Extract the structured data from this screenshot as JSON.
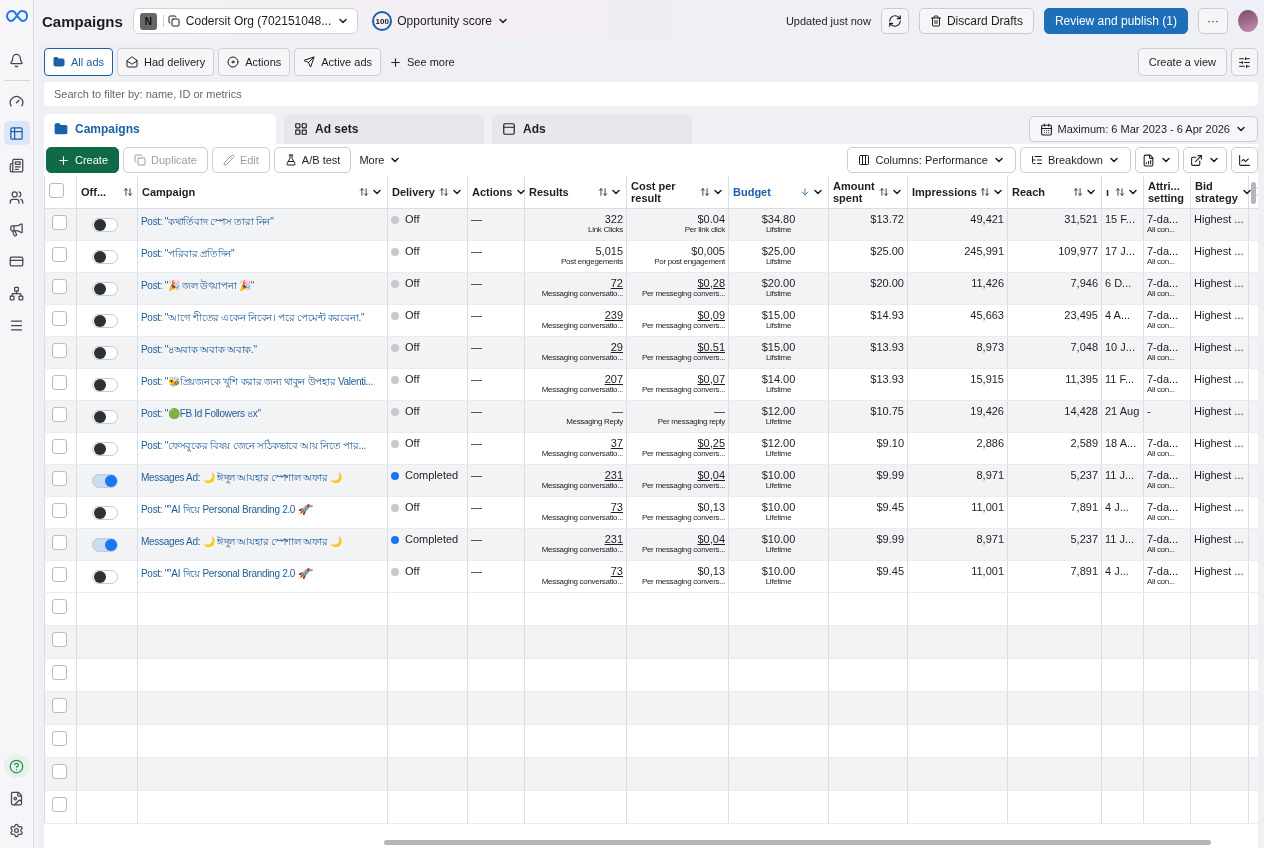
{
  "header": {
    "title": "Campaigns",
    "account": {
      "initial": "N",
      "name": "Codersit Org (702151048..."
    },
    "score": {
      "value": "100",
      "label": "Opportunity score"
    },
    "updated": "Updated just now",
    "discard": "Discard Drafts",
    "publish": "Review and publish (1)",
    "more": "···"
  },
  "filters": {
    "chips": [
      {
        "label": "All ads",
        "selected": true
      },
      {
        "label": "Had delivery",
        "selected": false
      },
      {
        "label": "Actions",
        "selected": false
      },
      {
        "label": "Active ads",
        "selected": false
      }
    ],
    "see_more": "See more",
    "create_view": "Create a view"
  },
  "search": {
    "placeholder": "Search to filter by: name, ID or metrics"
  },
  "tabs": [
    {
      "label": "Campaigns",
      "selected": true
    },
    {
      "label": "Ad sets",
      "selected": false
    },
    {
      "label": "Ads",
      "selected": false
    }
  ],
  "date_range": "Maximum: 6 Mar 2023 - 6 Apr 2026",
  "toolbar": {
    "create": "Create",
    "duplicate": {
      "label": "Duplicate",
      "disabled": true
    },
    "edit": {
      "label": "Edit",
      "disabled": true
    },
    "ab_test": "A/B test",
    "more": "More",
    "columns": "Columns: Performance",
    "breakdown": "Breakdown"
  },
  "table": {
    "columns": [
      {
        "label": "Off...",
        "sortable": true,
        "sorted": false,
        "menu": false
      },
      {
        "label": "Campaign",
        "sortable": true,
        "sorted": false,
        "menu": true
      },
      {
        "label": "Delivery",
        "sortable": true,
        "sorted": false,
        "menu": true
      },
      {
        "label": "Actions",
        "sortable": false,
        "sorted": false,
        "menu": true
      },
      {
        "label": "Results",
        "sortable": true,
        "sorted": false,
        "menu": true
      },
      {
        "label": "Cost per result",
        "sortable": true,
        "sorted": false,
        "menu": true
      },
      {
        "label": "Budget",
        "sortable": true,
        "sorted": true,
        "menu": true
      },
      {
        "label": "Amount spent",
        "sortable": true,
        "sorted": false,
        "menu": true
      },
      {
        "label": "Impressions",
        "sortable": true,
        "sorted": false,
        "menu": true
      },
      {
        "label": "Reach",
        "sortable": true,
        "sorted": false,
        "menu": true
      },
      {
        "label": "ı",
        "sortable": true,
        "sorted": false,
        "menu": true
      },
      {
        "label": "Attri... setting",
        "sortable": false,
        "sorted": false,
        "menu": false
      },
      {
        "label": "Bid strategy",
        "sortable": false,
        "sorted": false,
        "menu": true
      }
    ],
    "select_all": {
      "checked": false
    },
    "empty_rows": [
      {
        "checked": false
      },
      {
        "checked": false
      },
      {
        "checked": false
      },
      {
        "checked": false
      },
      {
        "checked": false
      },
      {
        "checked": false
      },
      {
        "checked": false
      }
    ],
    "rows": [
      {
        "checked": false,
        "on": false,
        "campaign": "Post: \"কথার্তিবাদ স্পেস তারা নিন\"",
        "delivery": {
          "status": "Off",
          "color": "#c6c8cc"
        },
        "actions": "—",
        "result": {
          "value": "322",
          "label": "Link Clicks",
          "underlined": false
        },
        "cost": {
          "value": "$0.04",
          "label": "Per link click",
          "underlined": false
        },
        "budget": {
          "value": "$34.80",
          "label": "Lifstime"
        },
        "spent": "$13.72",
        "impressions": "49,421",
        "reach": "31,521",
        "ends": "15 F...",
        "attribution": {
          "value": "7-da...",
          "label": "All con..."
        },
        "bid": "Highest ..."
      },
      {
        "checked": false,
        "on": false,
        "campaign": "Post: \"পরিবার প্রতিদিন\"",
        "delivery": {
          "status": "Off",
          "color": "#c6c8cc"
        },
        "actions": "—",
        "result": {
          "value": "5,015",
          "label": "Post engegements",
          "underlined": false
        },
        "cost": {
          "value": "$0,005",
          "label": "Por post engagement",
          "underlined": false
        },
        "budget": {
          "value": "$25.00",
          "label": "Lifstime"
        },
        "spent": "$25.00",
        "impressions": "245,991",
        "reach": "109,977",
        "ends": "17 J...",
        "attribution": {
          "value": "7-da...",
          "label": "All con..."
        },
        "bid": "Highest ..."
      },
      {
        "checked": false,
        "on": false,
        "campaign": "Post: \"🎉 জল উৎযাপনা 🎉\"",
        "delivery": {
          "status": "Off",
          "color": "#c6c8cc"
        },
        "actions": "—",
        "result": {
          "value": "72",
          "label": "Messaging conversatio...",
          "underlined": true
        },
        "cost": {
          "value": "$0,28",
          "label": "Per messeging convers...",
          "underlined": true
        },
        "budget": {
          "value": "$20.00",
          "label": "Lifstime"
        },
        "spent": "$20.00",
        "impressions": "11,426",
        "reach": "7,946",
        "ends": "6 D...",
        "attribution": {
          "value": "7-da...",
          "label": "All con..."
        },
        "bid": "Highest ..."
      },
      {
        "checked": false,
        "on": false,
        "campaign": "Post: \"আগে শীতের একেন নিবেন। পরে পেমেন্ট করবেনা.\"",
        "delivery": {
          "status": "Off",
          "color": "#c6c8cc"
        },
        "actions": "—",
        "result": {
          "value": "239",
          "label": "Messeging conversatio...",
          "underlined": true
        },
        "cost": {
          "value": "$0,09",
          "label": "Per messaging convers...",
          "underlined": true
        },
        "budget": {
          "value": "$15.00",
          "label": "Lifstime"
        },
        "spent": "$14.93",
        "impressions": "45,663",
        "reach": "23,495",
        "ends": "4 A...",
        "attribution": {
          "value": "7-da...",
          "label": "All con..."
        },
        "bid": "Highest ..."
      },
      {
        "checked": false,
        "on": false,
        "campaign": "Post: \"৪অবাক অবাক অবাক.\"",
        "delivery": {
          "status": "Off",
          "color": "#c6c8cc"
        },
        "actions": "—",
        "result": {
          "value": "29",
          "label": "Messaging conversatio...",
          "underlined": true
        },
        "cost": {
          "value": "$0.51",
          "label": "Per messaging convers...",
          "underlined": true
        },
        "budget": {
          "value": "$15.00",
          "label": "Lifstime"
        },
        "spent": "$13.93",
        "impressions": "8,973",
        "reach": "7,048",
        "ends": "10 J...",
        "attribution": {
          "value": "7-da...",
          "label": "All con..."
        },
        "bid": "Highest ..."
      },
      {
        "checked": false,
        "on": false,
        "campaign": "Post: \"🐝প্রিয়জনকে খুশি করার জন্য থাকুন উপহার Valenti...",
        "delivery": {
          "status": "Off",
          "color": "#c6c8cc"
        },
        "actions": "—",
        "result": {
          "value": "207",
          "label": "Messaging conversatio...",
          "underlined": true
        },
        "cost": {
          "value": "$0,07",
          "label": "Per messaging convers...",
          "underlined": true
        },
        "budget": {
          "value": "$14.00",
          "label": "Lifstime"
        },
        "spent": "$13.93",
        "impressions": "15,915",
        "reach": "11,395",
        "ends": "11 F...",
        "attribution": {
          "value": "7-da...",
          "label": "All con..."
        },
        "bid": "Highest ..."
      },
      {
        "checked": false,
        "on": false,
        "campaign": "Post: \"🟢FB Id Followers ৪x\"",
        "delivery": {
          "status": "Off",
          "color": "#c6c8cc"
        },
        "actions": "—",
        "result": {
          "value": "—",
          "label": "Messaging Reply",
          "underlined": false
        },
        "cost": {
          "value": "—",
          "label": "Per messaging reply",
          "underlined": false
        },
        "budget": {
          "value": "$12.00",
          "label": "Lifetime"
        },
        "spent": "$10.75",
        "impressions": "19,426",
        "reach": "14,428",
        "ends": "21 Aug",
        "attribution": {
          "value": "-"
        },
        "bid": "Highest ..."
      },
      {
        "checked": false,
        "on": false,
        "campaign": "Post: \"ফেসবুকের বিষয় জেনে সঠিকভাবে আয় নিতে পার...",
        "delivery": {
          "status": "Off",
          "color": "#c6c8cc"
        },
        "actions": "—",
        "result": {
          "value": "37",
          "label": "Messaging conversatio...",
          "underlined": true
        },
        "cost": {
          "value": "$0,25",
          "label": "Per messaging convers...",
          "underlined": true
        },
        "budget": {
          "value": "$12.00",
          "label": "Lifetime"
        },
        "spent": "$9.10",
        "impressions": "2,886",
        "reach": "2,589",
        "ends": "18 A...",
        "attribution": {
          "value": "7-da...",
          "label": "All con..."
        },
        "bid": "Highest ..."
      },
      {
        "checked": false,
        "on": true,
        "campaign": "Messages Ad: 🌙 ঈদুল আযহার স্পেশাল অফার 🌙",
        "delivery": {
          "status": "Completed",
          "color": "#1877f2"
        },
        "actions": "—",
        "result": {
          "value": "231",
          "label": "Messaging conversatio...",
          "underlined": true
        },
        "cost": {
          "value": "$0,04",
          "label": "Per messaging convers...",
          "underlined": true
        },
        "budget": {
          "value": "$10.00",
          "label": "Lifetime"
        },
        "spent": "$9.99",
        "impressions": "8,971",
        "reach": "5,237",
        "ends": "11 J...",
        "attribution": {
          "value": "7-da...",
          "label": "All con..."
        },
        "bid": "Highest ..."
      },
      {
        "checked": false,
        "on": false,
        "campaign": "Post: \"\"AI দিয়ে Personal Branding 2.0 🚀\"",
        "delivery": {
          "status": "Off",
          "color": "#c6c8cc"
        },
        "actions": "—",
        "result": {
          "value": "73",
          "label": "Messaging conversatio...",
          "underlined": true
        },
        "cost": {
          "value": "$0,13",
          "label": "Per messaging convers...",
          "underlined": false
        },
        "budget": {
          "value": "$10.00",
          "label": "Lifetime"
        },
        "spent": "$9.45",
        "impressions": "11,001",
        "reach": "7,891",
        "ends": "4 J...",
        "attribution": {
          "value": "7-da...",
          "label": "All con..."
        },
        "bid": "Highest ..."
      },
      {
        "checked": false,
        "on": true,
        "campaign": "Messages Ad: 🌙 ঈদুল আযহার স্পেশাল অফার 🌙",
        "delivery": {
          "status": "Completed",
          "color": "#1877f2"
        },
        "actions": "—",
        "result": {
          "value": "231",
          "label": "Messaging conversatio...",
          "underlined": true
        },
        "cost": {
          "value": "$0,04",
          "label": "Per messaging convers...",
          "underlined": true
        },
        "budget": {
          "value": "$10.00",
          "label": "Lifetime"
        },
        "spent": "$9.99",
        "impressions": "8,971",
        "reach": "5,237",
        "ends": "11 J...",
        "attribution": {
          "value": "7-da...",
          "label": "All con..."
        },
        "bid": "Highest ..."
      },
      {
        "checked": false,
        "on": false,
        "campaign": "Post: \"\"AI দিয়ে Personal Branding 2.0 🚀\"",
        "delivery": {
          "status": "Off",
          "color": "#c6c8cc"
        },
        "actions": "—",
        "result": {
          "value": "73",
          "label": "Messaging conversatio...",
          "underlined": true
        },
        "cost": {
          "value": "$0,13",
          "label": "Per messaging convers...",
          "underlined": false
        },
        "budget": {
          "value": "$10.00",
          "label": "Lifetime"
        },
        "spent": "$9.45",
        "impressions": "11,001",
        "reach": "7,891",
        "ends": "4 J...",
        "attribution": {
          "value": "7-da...",
          "label": "All con..."
        },
        "bid": "Highest ..."
      }
    ]
  }
}
